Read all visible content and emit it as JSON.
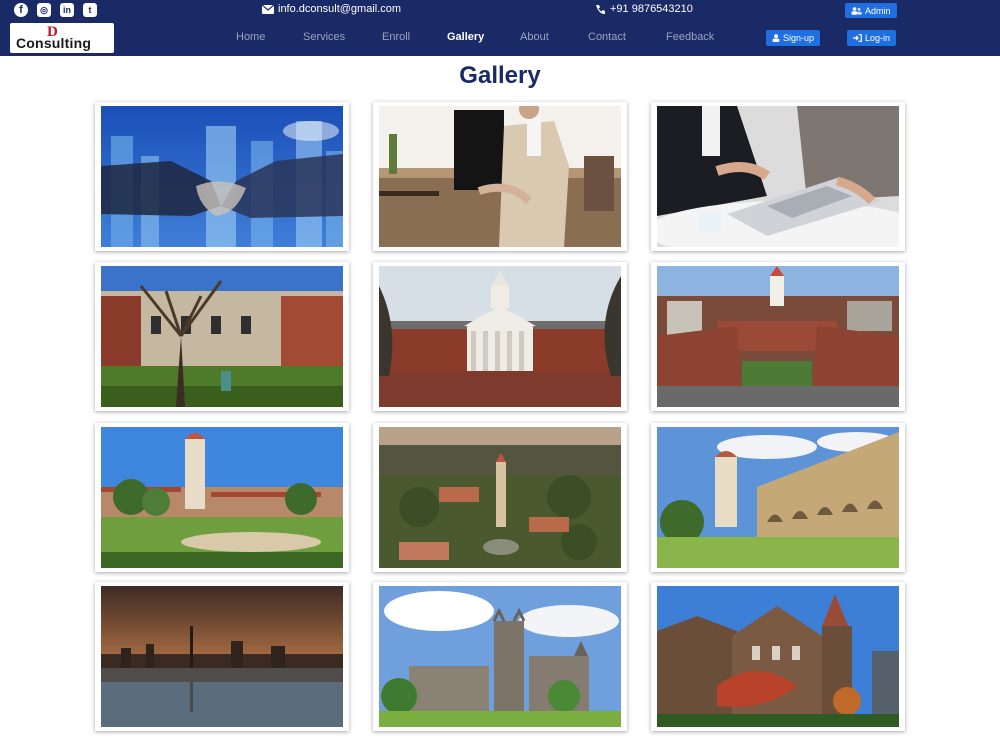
{
  "topbar": {
    "social": [
      {
        "name": "facebook-icon",
        "glyph": "f"
      },
      {
        "name": "instagram-icon",
        "glyph": "◎"
      },
      {
        "name": "linkedin-icon",
        "glyph": "in"
      },
      {
        "name": "twitter-icon",
        "glyph": "t"
      }
    ],
    "email": "info.dconsult@gmail.com",
    "phone": "+91 9876543210",
    "admin_label": "Admin"
  },
  "navbar": {
    "logo_mark": "D",
    "logo_text": "Consulting",
    "links": [
      "Home",
      "Services",
      "Enroll",
      "Gallery",
      "About",
      "Contact",
      "Feedback"
    ],
    "active": "Gallery",
    "signup_label": "Sign-up",
    "login_label": "Log-in"
  },
  "page": {
    "title": "Gallery"
  },
  "colors": {
    "nav_bg": "#1a2a66",
    "accent": "#1f6fe0",
    "title": "#1a2a66"
  },
  "gallery": [
    {
      "subject": "handshake-over-city"
    },
    {
      "subject": "businesswoman-with-laptop"
    },
    {
      "subject": "meeting-with-laptop"
    },
    {
      "subject": "campus-courtyard-tree"
    },
    {
      "subject": "colonnade-hall"
    },
    {
      "subject": "aerial-campus-cupola"
    },
    {
      "subject": "tower-quad-lawn"
    },
    {
      "subject": "aerial-campus-tower"
    },
    {
      "subject": "arcade-building-tower"
    },
    {
      "subject": "city-skyline-reflection"
    },
    {
      "subject": "gothic-college-tower"
    },
    {
      "subject": "victorian-gothic-hall"
    }
  ]
}
